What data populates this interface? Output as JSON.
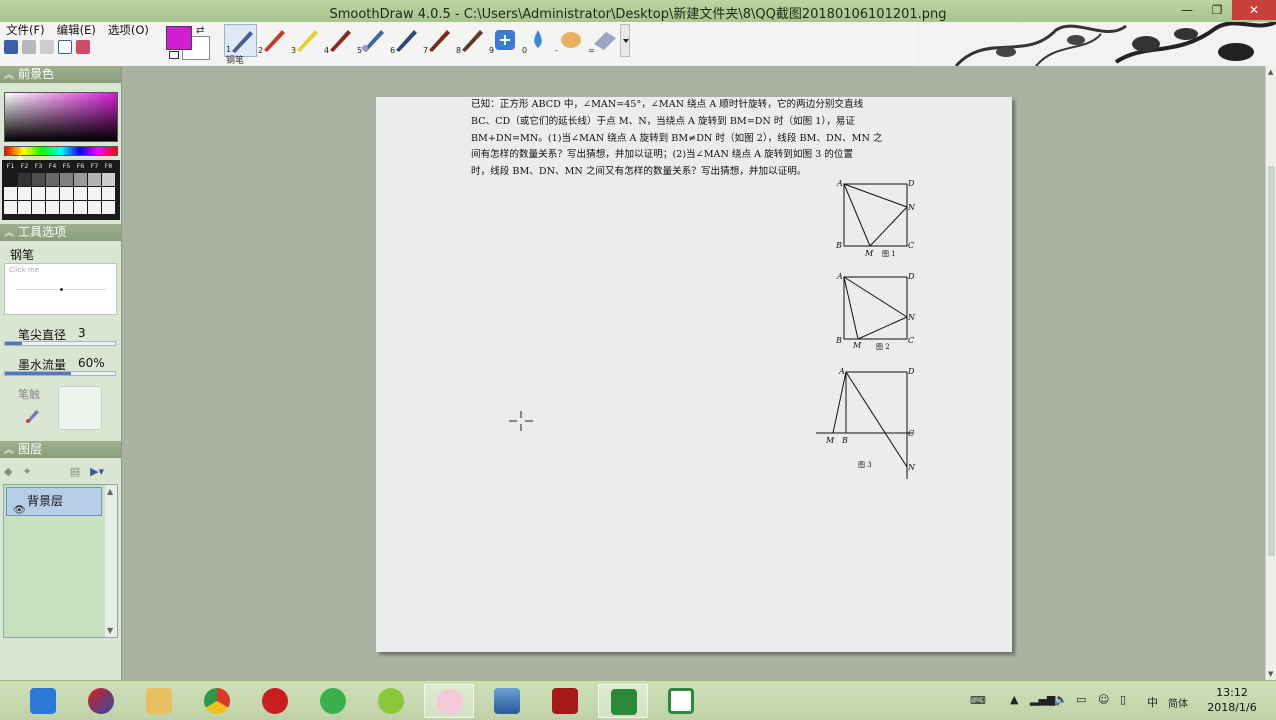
{
  "window": {
    "title": "SmoothDraw 4.0.5 - C:\\Users\\Administrator\\Desktop\\新建文件夹\\8\\QQ截图20180106101201.png",
    "controls": {
      "minimize": "—",
      "maximize": "❐",
      "close": "✕"
    }
  },
  "menu": [
    "文件(F)",
    "编辑(E)",
    "选项(O)"
  ],
  "colors": {
    "foreground": "#d21ed2",
    "background": "#ffffff"
  },
  "tools": {
    "numbers": [
      "1",
      "2",
      "3",
      "4",
      "5",
      "6",
      "7",
      "8",
      "9",
      "0",
      "-",
      "="
    ],
    "active_caption": "钢笔"
  },
  "panels": {
    "foreground": {
      "title": "前景色",
      "fkeys": [
        "F1",
        "F2",
        "F3",
        "F4",
        "F5",
        "F6",
        "F7",
        "F8"
      ]
    },
    "tool_options": {
      "title": "工具选项",
      "tool_name": "钢笔",
      "click_hint": "Click me",
      "tip_diameter_label": "笔尖直径",
      "tip_diameter_value": "3",
      "tip_diameter_fraction": 0.15,
      "ink_flow_label": "墨水流量",
      "ink_flow_value": "60%",
      "ink_flow_fraction": 0.6,
      "brush_tip_label": "笔触"
    },
    "layers": {
      "title": "图层",
      "items": [
        "背景层"
      ]
    }
  },
  "document": {
    "problem_text": "已知：正方形 ABCD 中，∠MAN=45°，∠MAN 绕点 A 顺时针旋转，它的两边分别交直线\nBC、CD（或它们的延长线）于点 M、N，当绕点 A 旋转到 BM=DN 时（如图 1），易证\nBM+DN=MN。(1)当∠MAN 绕点 A 旋转到 BM≠DN 时（如图 2），线段 BM、DN、MN 之\n间有怎样的数量关系？写出猜想，并加以证明；(2)当∠MAN 绕点 A 旋转到如图 3 的位置\n时，线段 BM、DN、MN 之间又有怎样的数量关系？写出猜想，并加以证明。",
    "fig1": {
      "A": "A",
      "B": "B",
      "C": "C",
      "D": "D",
      "M": "M",
      "N": "N",
      "caption": "图 1"
    },
    "fig2": {
      "A": "A",
      "B": "B",
      "C": "C",
      "D": "D",
      "M": "M",
      "N": "N",
      "caption": "图 2"
    },
    "fig3": {
      "A": "A",
      "B": "B",
      "C": "C",
      "D": "D",
      "M": "M",
      "N": "N",
      "caption": "图 3"
    }
  },
  "taskbar": {
    "tray": {
      "ime": "中",
      "lang_mode": "简体",
      "time": "13:12",
      "date": "2018/1/6"
    }
  }
}
